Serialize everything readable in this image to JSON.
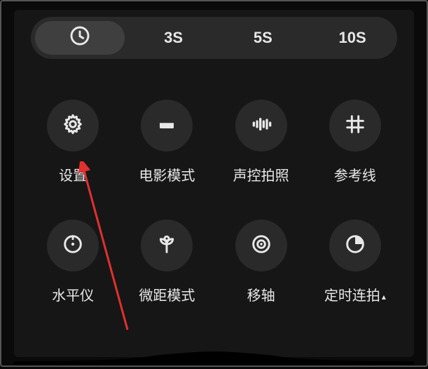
{
  "timer": {
    "options": [
      "clock-icon",
      "3S",
      "5S",
      "10S"
    ],
    "labels": {
      "opt1": "3S",
      "opt2": "5S",
      "opt3": "10S"
    },
    "selected_index": 0
  },
  "grid": {
    "items": [
      {
        "icon": "gear-icon",
        "label": "设置"
      },
      {
        "icon": "cinema-icon",
        "label": "电影模式"
      },
      {
        "icon": "voice-icon",
        "label": "声控拍照"
      },
      {
        "icon": "grid-icon",
        "label": "参考线"
      },
      {
        "icon": "level-icon",
        "label": "水平仪"
      },
      {
        "icon": "macro-icon",
        "label": "微距模式"
      },
      {
        "icon": "tiltshift-icon",
        "label": "移轴"
      },
      {
        "icon": "interval-icon",
        "label": "定时连拍",
        "has_triangle": true
      }
    ]
  },
  "annotation": {
    "arrow_color": "#e2302e"
  }
}
